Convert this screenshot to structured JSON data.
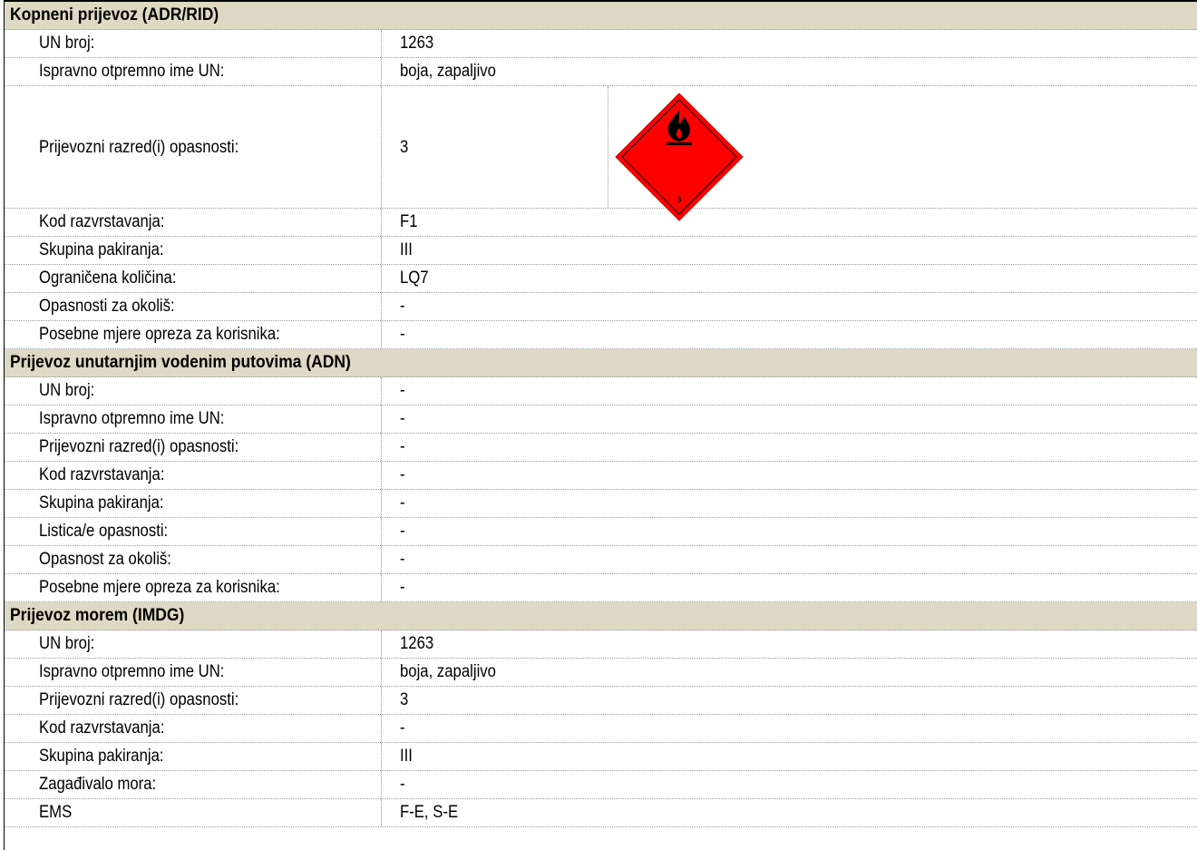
{
  "sections": [
    {
      "title": "Kopneni prijevoz (ADR/RID)",
      "rows": [
        {
          "label": "UN broj:",
          "value": "1263"
        },
        {
          "label": "Ispravno otpremno ime UN:",
          "value": "boja, zapaljivo"
        },
        {
          "label": "Prijevozni razred(i) opasnosti:",
          "value": "3"
        },
        {
          "label": "Kod razvrstavanja:",
          "value": "F1"
        },
        {
          "label": "Skupina pakiranja:",
          "value": "III"
        },
        {
          "label": "Ograničena količina:",
          "value": "LQ7"
        },
        {
          "label": "Opasnosti za okoliš:",
          "value": "-"
        },
        {
          "label": "Posebne mjere opreza za korisnika:",
          "value": "-"
        }
      ]
    },
    {
      "title": "Prijevoz unutarnjim vodenim putovima (ADN)",
      "rows": [
        {
          "label": "UN broj:",
          "value": "-"
        },
        {
          "label": "Ispravno otpremno ime UN:",
          "value": "-"
        },
        {
          "label": "Prijevozni razred(i) opasnosti:",
          "value": "-"
        },
        {
          "label": "Kod razvrstavanja:",
          "value": "-"
        },
        {
          "label": "Skupina pakiranja:",
          "value": "-"
        },
        {
          "label": "Listica/e opasnosti:",
          "value": "-"
        },
        {
          "label": "Opasnost za okoliš:",
          "value": "-"
        },
        {
          "label": "Posebne mjere opreza za korisnika:",
          "value": "-"
        }
      ]
    },
    {
      "title": "Prijevoz morem (IMDG)",
      "rows": [
        {
          "label": "UN broj:",
          "value": "1263"
        },
        {
          "label": "Ispravno otpremno ime UN:",
          "value": "boja, zapaljivo"
        },
        {
          "label": "Prijevozni razred(i) opasnosti:",
          "value": "3"
        },
        {
          "label": "Kod razvrstavanja:",
          "value": "-"
        },
        {
          "label": "Skupina pakiranja:",
          "value": "III"
        },
        {
          "label": "Zagađivalo mora:",
          "value": "-"
        },
        {
          "label": "EMS",
          "value": "F-E, S-E"
        }
      ]
    }
  ],
  "hazard_label": {
    "icon": "flammable-liquid-class-3-icon",
    "class_number": "3",
    "color": "#ff0000"
  }
}
